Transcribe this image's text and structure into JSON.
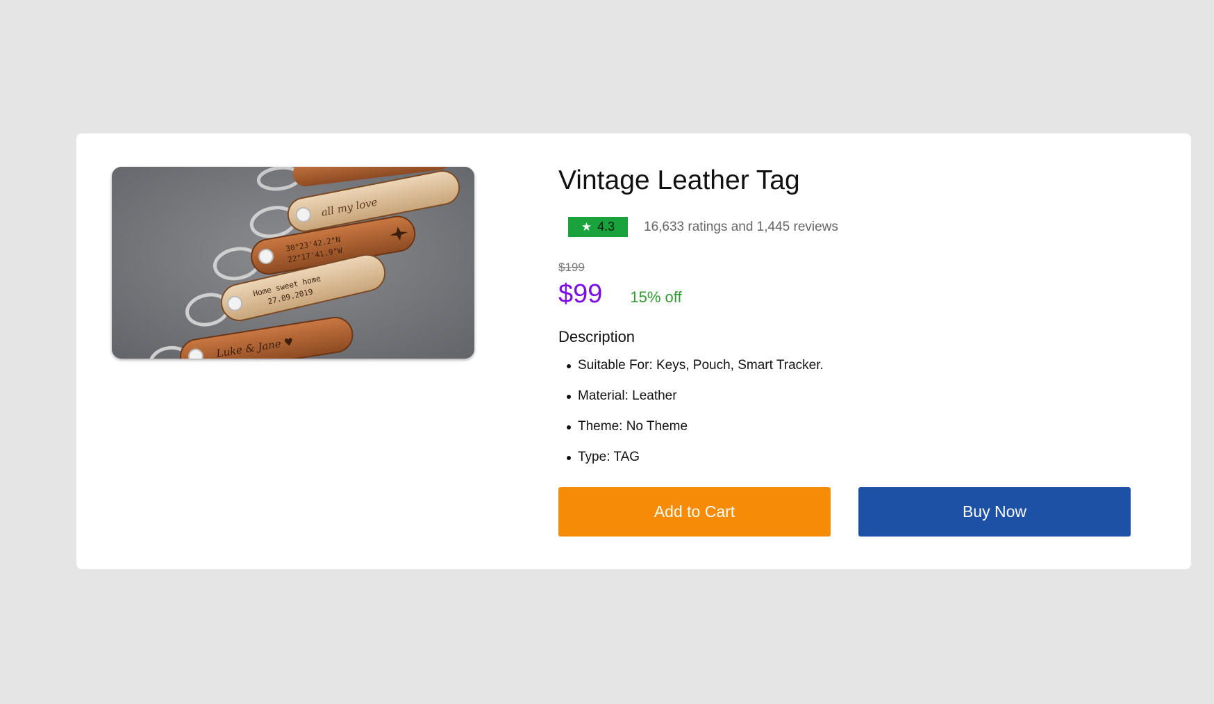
{
  "product": {
    "image_alt": "Engraved leather key tags",
    "title": "Vintage Leather Tag",
    "rating": {
      "value": "4.3",
      "summary": "16,633 ratings and 1,445 reviews",
      "badge_color": "#1aa33c"
    },
    "price": {
      "original": "$199",
      "current": "$99",
      "discount": "15% off",
      "current_color": "#7a0ee6",
      "discount_color": "#2f9a2f"
    },
    "description": {
      "heading": "Description",
      "items": [
        "Suitable For: Keys, Pouch, Smart Tracker.",
        "Material: Leather",
        "Theme: No Theme",
        "Type: TAG"
      ]
    },
    "actions": {
      "add_to_cart": "Add to Cart",
      "buy_now": "Buy Now",
      "add_to_cart_color": "#f58b07",
      "buy_now_color": "#1c51a6"
    },
    "image_engravings": {
      "tag1": "all my love",
      "tag2_line1": "30°23'42.2\"N",
      "tag2_line2": "22°17'41.9\"W",
      "tag3_line1": "Home sweet home",
      "tag3_line2": "27.09.2019",
      "tag4": "Luke & Jane ♥"
    }
  }
}
